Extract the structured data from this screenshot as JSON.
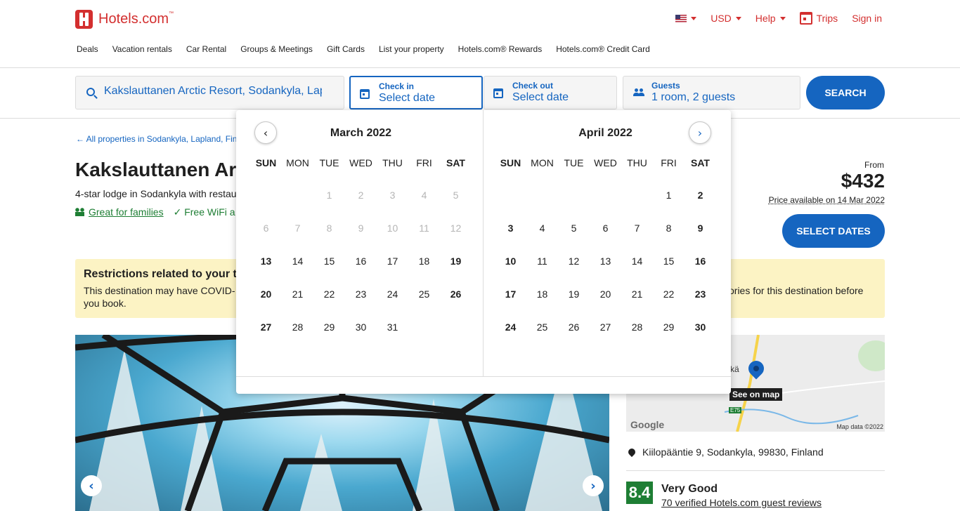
{
  "header": {
    "brand": "Hotels.com",
    "brand_tm": "™",
    "currency": "USD",
    "help": "Help",
    "trips": "Trips",
    "sign_in": "Sign in",
    "nav": [
      "Deals",
      "Vacation rentals",
      "Car Rental",
      "Groups & Meetings",
      "Gift Cards",
      "List your property",
      "Hotels.com® Rewards",
      "Hotels.com® Credit Card"
    ]
  },
  "search": {
    "destination_value": "Kakslauttanen Arctic Resort, Sodankyla, Lapland",
    "checkin_label": "Check in",
    "checkin_value": "Select date",
    "checkout_label": "Check out",
    "checkout_value": "Select date",
    "guests_label": "Guests",
    "guests_value": "1 room, 2 guests",
    "button": "SEARCH"
  },
  "property": {
    "breadcrumb": "All properties in Sodankyla, Lapland, Fin",
    "title": "Kakslauttanen Ar",
    "subtitle": "4-star lodge in Sodankyla with restau",
    "feature_1": "Great for families",
    "feature_2": "Free WiFi a",
    "price_from": "From",
    "price": "$432",
    "price_note": "Price available on 14 Mar 2022",
    "select_dates": "SELECT DATES"
  },
  "alert": {
    "title": "Restrictions related to your t",
    "line1": "This destination may have COVID-",
    "line2": "you book.",
    "line1_right": "ories for this destination before"
  },
  "map": {
    "see_on_map": "See on map",
    "provider": "Google",
    "map_data": "Map data ©2022",
    "road": "E75",
    "place": "kä"
  },
  "location": {
    "address": "Kiilopääntie 9, Sodankyla, 99830, Finland"
  },
  "rating": {
    "score": "8.4",
    "label": "Very Good",
    "reviews": "70 verified Hotels.com guest reviews"
  },
  "calendar": {
    "weekdays": [
      "SUN",
      "MON",
      "TUE",
      "WED",
      "THU",
      "FRI",
      "SAT"
    ],
    "months": [
      {
        "title": "March 2022",
        "days": [
          "",
          "",
          "1",
          "2",
          "3",
          "4",
          "5",
          "6",
          "7",
          "8",
          "9",
          "10",
          "11",
          "12",
          "13",
          "14",
          "15",
          "16",
          "17",
          "18",
          "19",
          "20",
          "21",
          "22",
          "23",
          "24",
          "25",
          "26",
          "27",
          "28",
          "29",
          "30",
          "31"
        ],
        "disabled_until": "13"
      },
      {
        "title": "April 2022",
        "days": [
          "",
          "",
          "",
          "",
          "",
          "1",
          "2",
          "3",
          "4",
          "5",
          "6",
          "7",
          "8",
          "9",
          "10",
          "11",
          "12",
          "13",
          "14",
          "15",
          "16",
          "17",
          "18",
          "19",
          "20",
          "21",
          "22",
          "23",
          "24",
          "25",
          "26",
          "27",
          "28",
          "29",
          "30"
        ],
        "disabled_until": "0"
      }
    ]
  },
  "colors": {
    "brand": "#d32f2f",
    "primary": "#1565c0",
    "success": "#1e7e34",
    "alert_bg": "#fcf3c4"
  }
}
